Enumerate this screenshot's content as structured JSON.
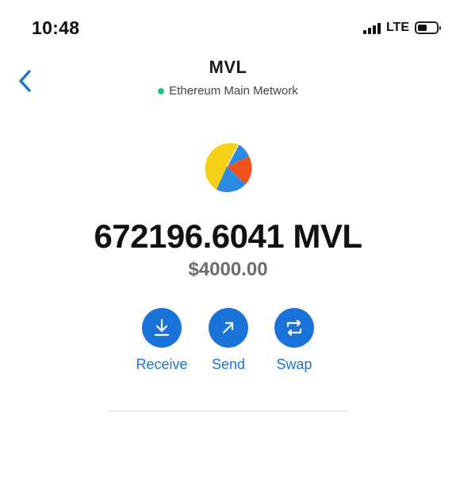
{
  "status_bar": {
    "time": "10:48",
    "network_type": "LTE",
    "signal_bars": 4,
    "battery_level": 0.5
  },
  "header": {
    "back_icon": "chevron-left-icon",
    "title": "MVL",
    "network_label": "Ethereum Main Metwork",
    "network_dot_color": "#2bbf8e"
  },
  "token": {
    "icon": "pie-token-icon",
    "balance": "672196.6041 MVL",
    "fiat_value": "$4000.00"
  },
  "actions": [
    {
      "label": "Receive",
      "icon": "download-arrow-icon"
    },
    {
      "label": "Send",
      "icon": "arrow-up-right-icon"
    },
    {
      "label": "Swap",
      "icon": "swap-arrows-icon"
    }
  ],
  "colors": {
    "accent": "#1a73d8",
    "back_arrow": "#1a73d8",
    "token_yellow": "#f6d016",
    "token_orange": "#f2511b",
    "token_blue": "#2a8be0"
  }
}
